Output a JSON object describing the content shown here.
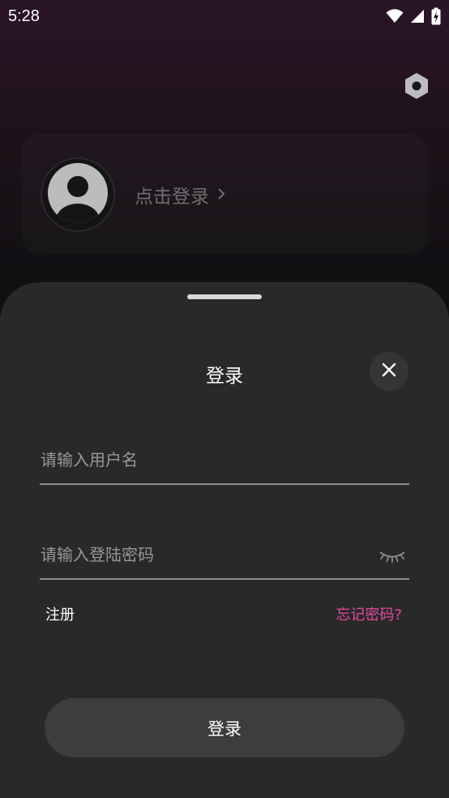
{
  "status_bar": {
    "time": "5:28",
    "icons": [
      "wifi-icon",
      "cell-signal-icon",
      "battery-charging-icon"
    ]
  },
  "settings": {
    "icon": "hexagon-settings-icon"
  },
  "profile": {
    "avatar_icon": "user-avatar-icon",
    "login_prompt": "点击登录",
    "chevron": "›"
  },
  "login_sheet": {
    "title": "登录",
    "close_icon": "close-icon",
    "username_placeholder": "请输入用户名",
    "username_value": "",
    "password_placeholder": "请输入登陆密码",
    "password_value": "",
    "password_toggle_icon": "eye-closed-icon",
    "register_label": "注册",
    "forgot_password_label": "忘记密码?",
    "submit_label": "登录"
  },
  "colors": {
    "sheet_background": "#29292c",
    "accent_pink": "#e6499b",
    "button_background": "#3d3d40"
  }
}
